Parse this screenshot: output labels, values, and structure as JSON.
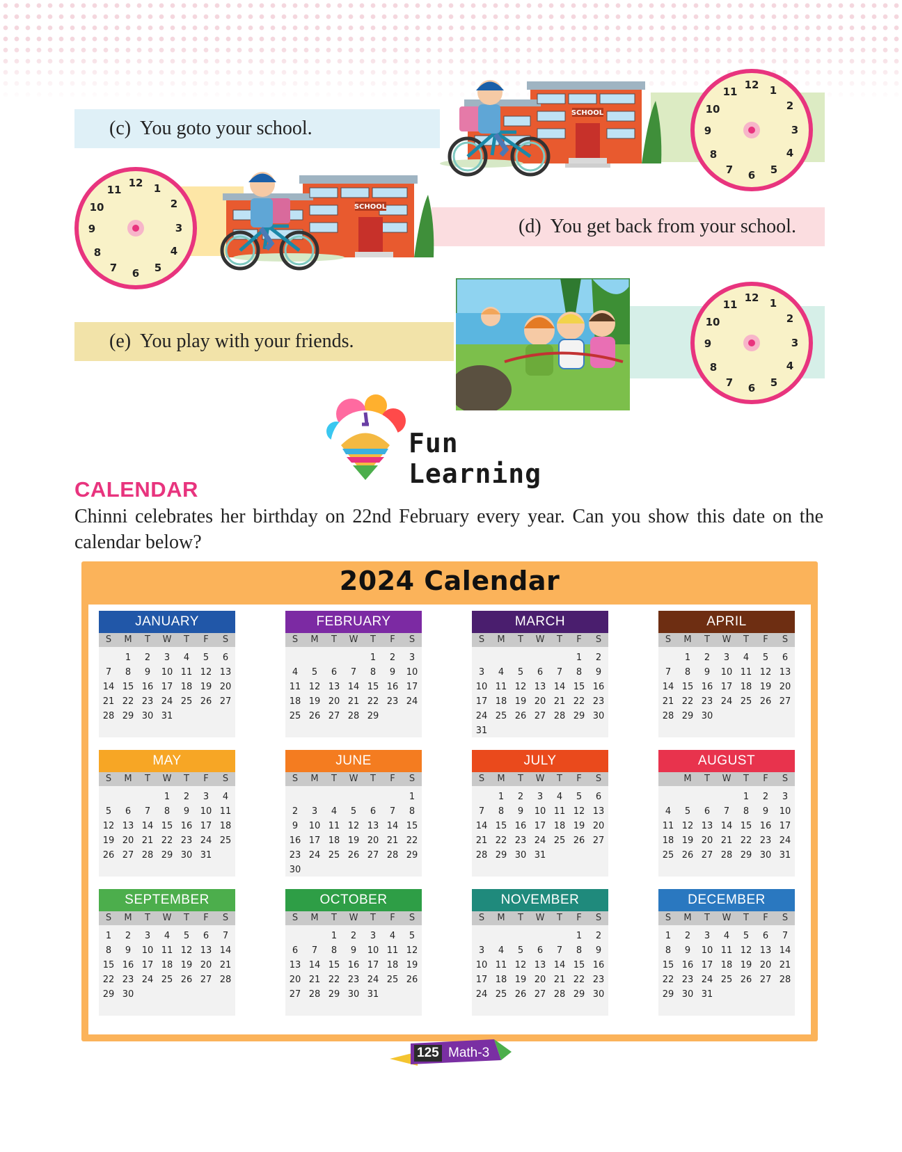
{
  "activities": [
    {
      "label": "(c)",
      "text": "You goto your school."
    },
    {
      "label": "(d)",
      "text": "You get back from your school."
    },
    {
      "label": "(e)",
      "text": "You play with your friends."
    }
  ],
  "clock_numbers": [
    "12",
    "1",
    "2",
    "3",
    "4",
    "5",
    "6",
    "7",
    "8",
    "9",
    "10",
    "11"
  ],
  "school_sign": "SCHOOL",
  "fun_learning": {
    "title": "Fun Learning"
  },
  "section": {
    "heading": "CALENDAR",
    "paragraph": "Chinni celebrates her birthday on 22nd February every year. Can you show this date on the calendar below?"
  },
  "calendar": {
    "title": "2024  Calendar",
    "weekdays": [
      "S",
      "M",
      "T",
      "W",
      "T",
      "F",
      "S"
    ],
    "months": [
      {
        "name": "JANUARY",
        "color": "#2157a8",
        "start": 1,
        "days": 31
      },
      {
        "name": "FEBRUARY",
        "color": "#7c2aa3",
        "start": 4,
        "days": 29
      },
      {
        "name": "MARCH",
        "color": "#4a1e6e",
        "start": 5,
        "days": 31
      },
      {
        "name": "APRIL",
        "color": "#6e2e12",
        "start": 1,
        "days": 30
      },
      {
        "name": "MAY",
        "color": "#f7a625",
        "start": 3,
        "days": 31
      },
      {
        "name": "JUNE",
        "color": "#f47c20",
        "start": 6,
        "days": 30
      },
      {
        "name": "JULY",
        "color": "#ea4a1c",
        "start": 1,
        "days": 31
      },
      {
        "name": "AUGUST",
        "color": "#e8334d",
        "start": 4,
        "days": 31,
        "weekdays": [
          "",
          "M",
          "T",
          "W",
          "T",
          "F",
          "S"
        ]
      },
      {
        "name": "SEPTEMBER",
        "color": "#4cae4c",
        "start": 0,
        "days": 30
      },
      {
        "name": "OCTOBER",
        "color": "#2e9e46",
        "start": 2,
        "days": 31
      },
      {
        "name": "NOVEMBER",
        "color": "#1f8a7c",
        "start": 5,
        "days": 30
      },
      {
        "name": "DECEMBER",
        "color": "#2a78c0",
        "start": 0,
        "days": 31
      }
    ]
  },
  "footer": {
    "page": "125",
    "subject": "Math-3"
  }
}
